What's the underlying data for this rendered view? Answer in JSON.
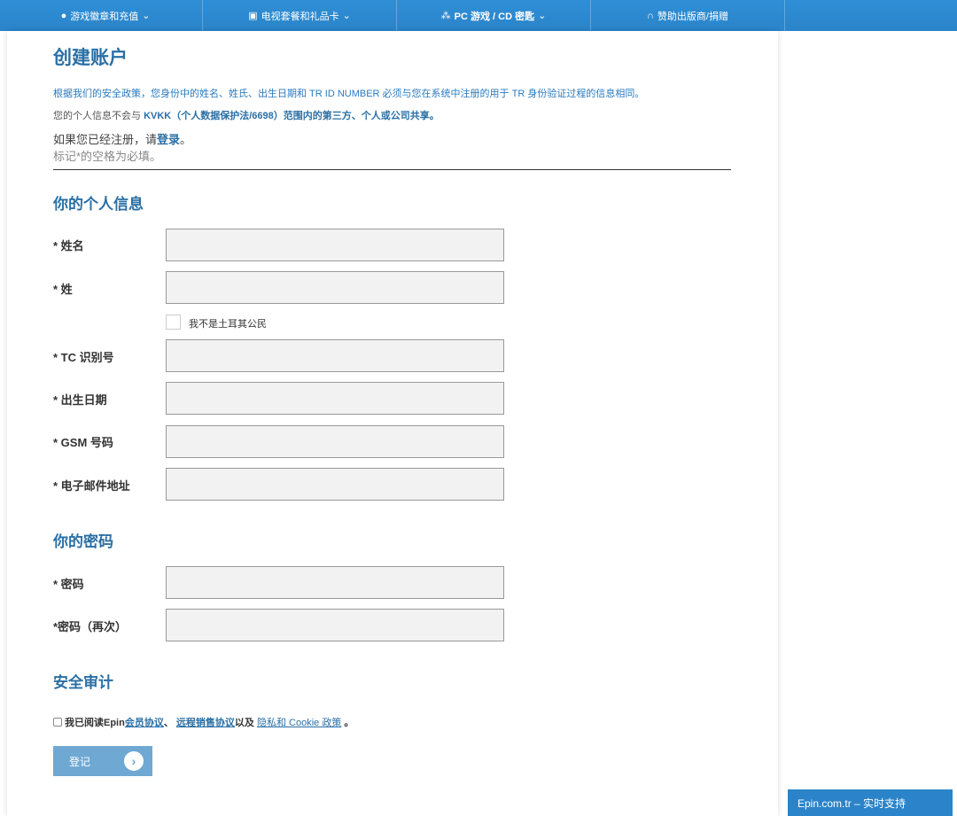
{
  "nav": [
    {
      "icon": "gamepad-icon",
      "label": "游戏徽章和充值"
    },
    {
      "icon": "gift-icon",
      "label": "电视套餐和礼品卡"
    },
    {
      "icon": "cubes-icon",
      "label": "PC 游戏 / CD 密匙"
    },
    {
      "icon": "headphones-icon",
      "label": "赞助出版商/捐赠"
    }
  ],
  "title": "创建账户",
  "policy": "根据我们的安全政策，您身份中的姓名、姓氏、出生日期和 TR ID NUMBER 必须与您在系统中注册的用于 TR 身份验证过程的信息相同。",
  "kvkk_pre": "您的个人信息不会与 ",
  "kvkk_bold": "KVKK（个人数据保护法/6698）范围内的第三方、个人或公司共享。",
  "login_pre": "如果您已经注册，请",
  "login_link": "登录",
  "login_post": "。",
  "required_note": "标记*的空格为必填。",
  "personal": {
    "heading": "你的个人信息",
    "first_name": "* 姓名",
    "last_name": "* 姓",
    "not_citizen": "我不是土耳其公民",
    "tc": "* TC 识别号",
    "dob": "* 出生日期",
    "gsm": "* GSM 号码",
    "email": "* 电子邮件地址"
  },
  "password": {
    "heading": "你的密码",
    "password": "* 密码",
    "password_again": "*密码（再次）"
  },
  "security": {
    "heading": "安全审计",
    "agree_pre": "我已阅读Epin ",
    "link1": "会员协议",
    "sep": "、 ",
    "link2": "远程销售协议",
    "mid": "以及 ",
    "link3": "隐私和 Cookie 政策",
    "end": " 。"
  },
  "submit": "登记",
  "support": "Epin.com.tr – 实时支持"
}
